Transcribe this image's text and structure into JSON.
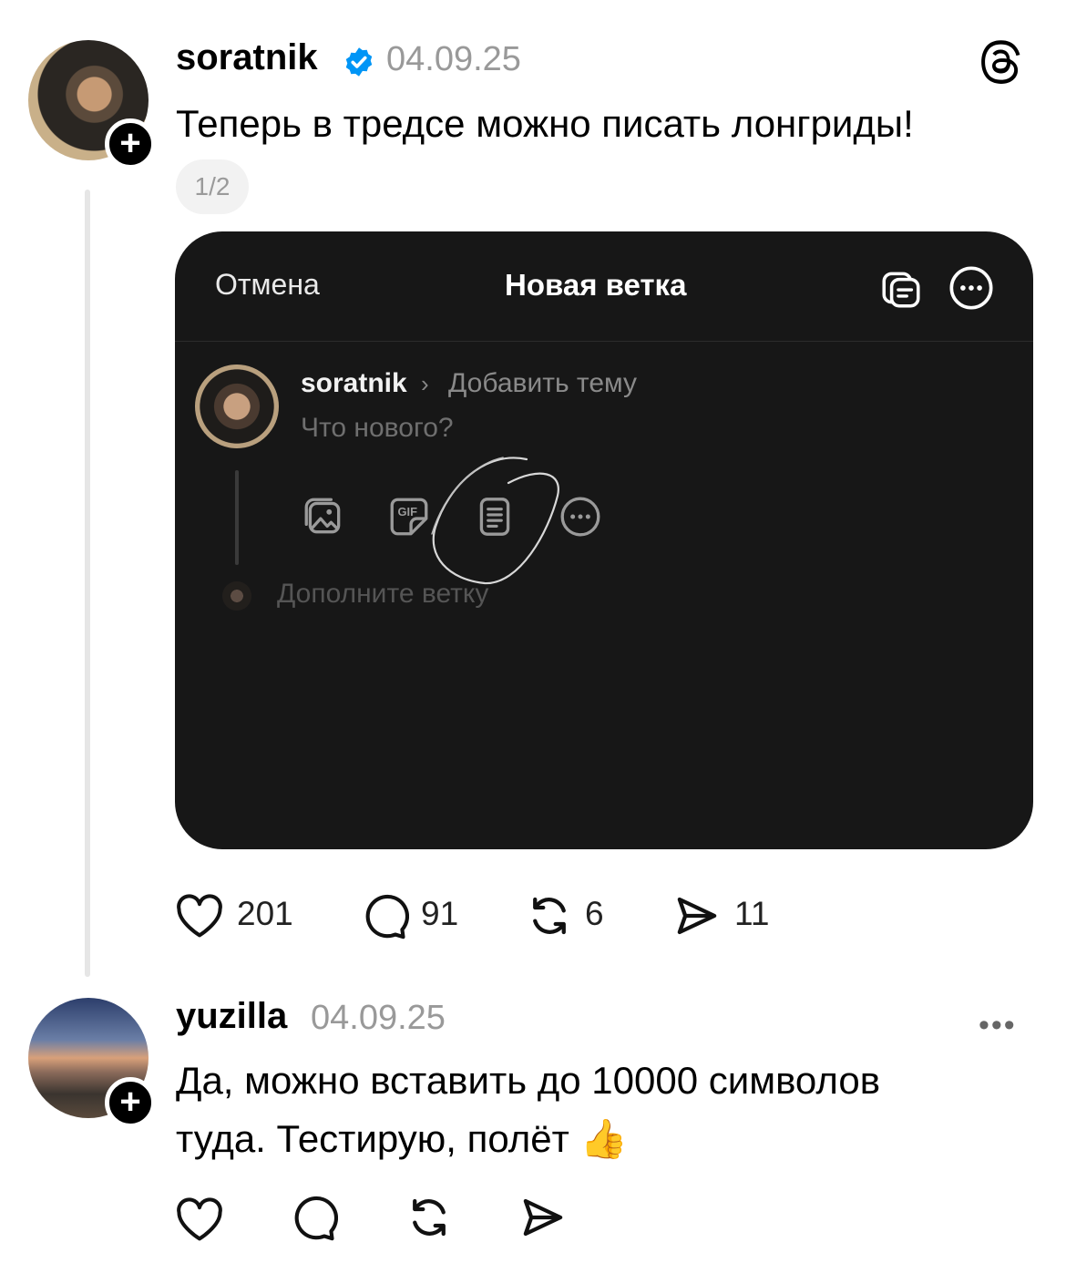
{
  "post": {
    "username": "soratnik",
    "date": "04.09.25",
    "text": "Теперь в тредсе можно писать лонгриды!",
    "page_indicator": "1/2",
    "likes": "201",
    "comments": "91",
    "reposts": "6",
    "shares": "11"
  },
  "embedded": {
    "cancel_label": "Отмена",
    "title": "Новая ветка",
    "username": "soratnik",
    "add_topic_placeholder": "Добавить тему",
    "compose_placeholder": "Что нового?",
    "add_thread_placeholder": "Дополните ветку",
    "gif_label": "GIF"
  },
  "reply": {
    "username": "yuzilla",
    "date": "04.09.25",
    "text_line1": "Да, можно вставить до 10000 символов",
    "text_line2": "туда. Тестирую, полёт",
    "emoji": "👍"
  },
  "colors": {
    "verified": "#0095f6",
    "dark_card": "#171717",
    "muted": "#999999"
  },
  "icons": [
    "threads-logo-icon",
    "verified-badge-icon",
    "heart-icon",
    "comment-icon",
    "repost-icon",
    "share-icon",
    "more-icon",
    "gallery-icon",
    "gif-icon",
    "document-icon",
    "drafts-icon"
  ]
}
